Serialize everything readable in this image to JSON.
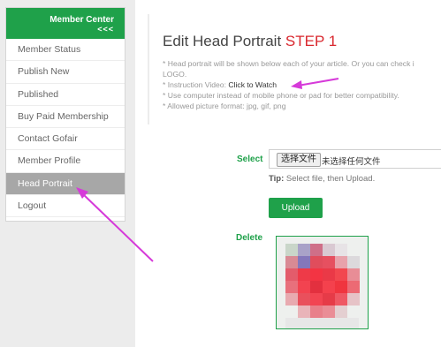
{
  "sidebar": {
    "header_title": "Member Center",
    "back_label": "<<<",
    "items": [
      {
        "label": "Member Status"
      },
      {
        "label": "Publish New"
      },
      {
        "label": "Published"
      },
      {
        "label": "Buy Paid Membership"
      },
      {
        "label": "Contact Gofair"
      },
      {
        "label": "Member Profile"
      },
      {
        "label": "Head Portrait"
      },
      {
        "label": "Logout"
      }
    ],
    "active_index": 6
  },
  "main": {
    "title": "Edit Head Portrait",
    "step": "STEP 1",
    "notes": {
      "line1": "* Head portrait will be shown below each of your article. Or you can check i",
      "line1b": "LOGO.",
      "line2_prefix": "* Instruction Video: ",
      "line2_link": "Click to Watch",
      "line3": "* Use computer instead of mobile phone or pad for better compatibility.",
      "line4": "* Allowed picture format: jpg, gif, png"
    },
    "select_label": "Select",
    "file_button": "选择文件",
    "file_status": "未选择任何文件",
    "tip_label": "Tip:",
    "tip_text": " Select file, then Upload.",
    "upload_button": "Upload",
    "delete_label": "Delete"
  },
  "colors": {
    "accent_green": "#1fa14a",
    "step_red": "#d9272e",
    "annotation_arrow": "#d63ad9",
    "active_menu_bg": "#a7a7a7"
  }
}
